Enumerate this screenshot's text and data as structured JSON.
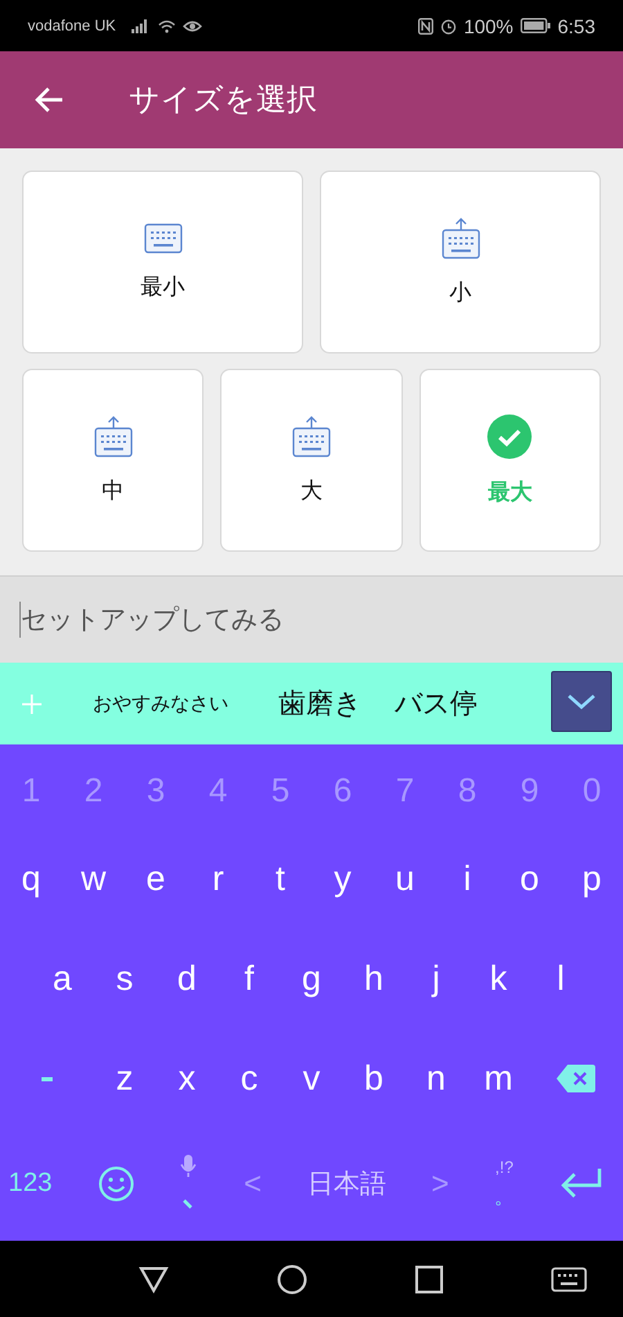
{
  "status_bar": {
    "carrier": "vodafone UK",
    "battery": "100%",
    "time": "6:53"
  },
  "app_bar": {
    "title": "サイズを選択"
  },
  "sizes": [
    {
      "label": "最小",
      "kind": "plain",
      "selected": false
    },
    {
      "label": "小",
      "kind": "raise",
      "selected": false
    },
    {
      "label": "中",
      "kind": "raise",
      "selected": false
    },
    {
      "label": "大",
      "kind": "raise",
      "selected": false
    },
    {
      "label": "最大",
      "selected": true
    }
  ],
  "input": {
    "placeholder": "セットアップしてみる"
  },
  "suggestions": [
    "おやすみなさい",
    "歯磨き",
    "バス停"
  ],
  "keyboard": {
    "number_row": [
      "1",
      "2",
      "3",
      "4",
      "5",
      "6",
      "7",
      "8",
      "9",
      "0"
    ],
    "rows": [
      [
        "q",
        "w",
        "e",
        "r",
        "t",
        "y",
        "u",
        "i",
        "o",
        "p"
      ],
      [
        "a",
        "s",
        "d",
        "f",
        "g",
        "h",
        "j",
        "k",
        "l"
      ],
      [
        "z",
        "x",
        "c",
        "v",
        "b",
        "n",
        "m"
      ]
    ],
    "numbers_key": "123",
    "prev": "<",
    "language": "日本語",
    "next": ">",
    "punctuation": ",!?",
    "period": "。"
  }
}
